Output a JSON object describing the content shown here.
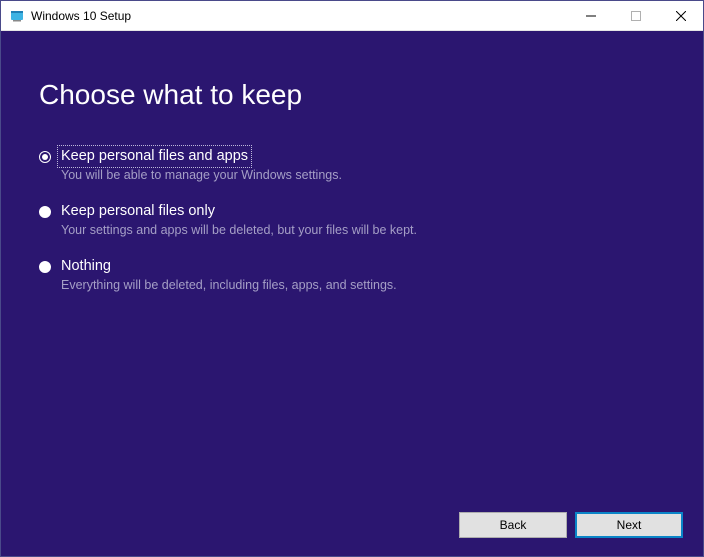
{
  "window": {
    "title": "Windows 10 Setup"
  },
  "heading": "Choose what to keep",
  "options": [
    {
      "label": "Keep personal files and apps",
      "desc": "You will be able to manage your Windows settings.",
      "selected": true,
      "focused": true
    },
    {
      "label": "Keep personal files only",
      "desc": "Your settings and apps will be deleted, but your files will be kept.",
      "selected": false,
      "focused": false
    },
    {
      "label": "Nothing",
      "desc": "Everything will be deleted, including files, apps, and settings.",
      "selected": false,
      "focused": false
    }
  ],
  "buttons": {
    "back": "Back",
    "next": "Next"
  }
}
